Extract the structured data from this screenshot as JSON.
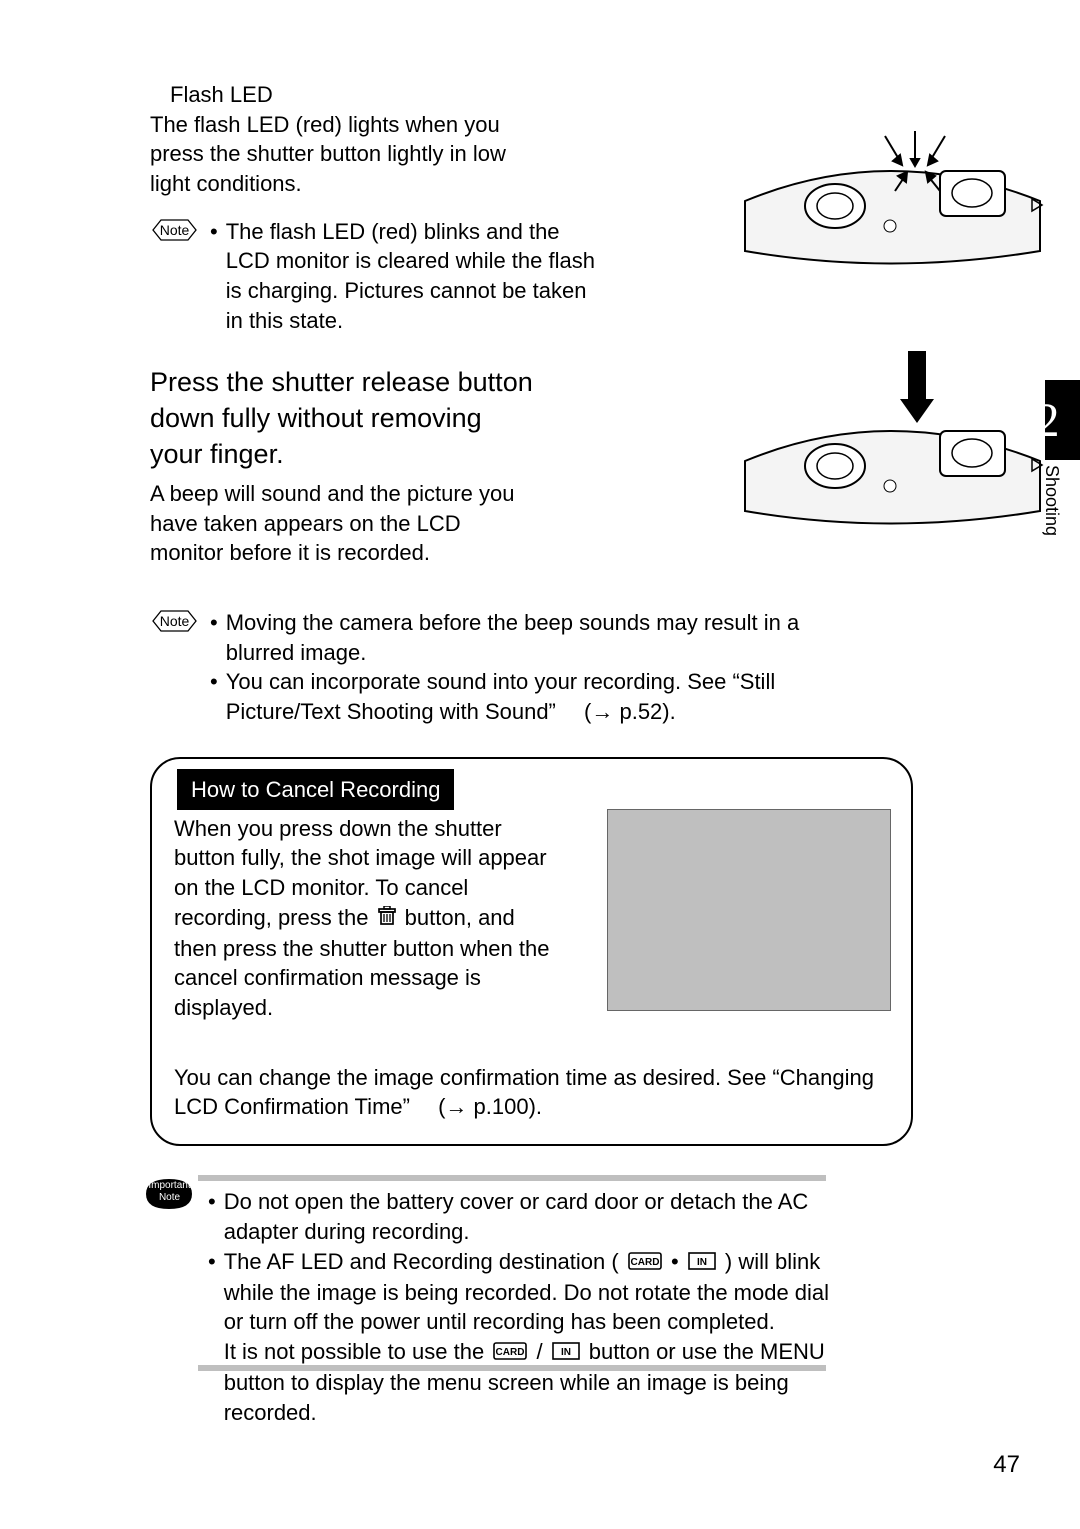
{
  "page_number": "47",
  "chapter": {
    "number": "2",
    "title": "Shooting"
  },
  "section": {
    "heading": "Flash LED",
    "intro": "The flash LED (red) lights when you press the shutter button lightly in low light conditions.",
    "note1_label": "Note",
    "note1_text": "The flash LED (red) blinks and the LCD monitor is cleared while the flash is charging. Pictures cannot be taken in this state."
  },
  "step": {
    "instruction": "Press the shutter release button down fully without removing your finger.",
    "result": "A beep will sound and the picture you have taken appears on the LCD monitor before it is recorded."
  },
  "note2": {
    "label": "Note",
    "items": [
      "Moving the camera before the beep sounds may result in a blurred image.",
      "You can incorporate sound into your recording. See “Still Picture/Text Shooting with Sound”"
    ],
    "ref": "p.52)."
  },
  "panel": {
    "title": "How to Cancel Recording",
    "text1_a": "When you press down the shutter button fully, the shot image will appear on the LCD monitor. To cancel recording, press the ",
    "text1_b": " button, and then press the shutter button when the cancel confirmation message is displayed.",
    "text2": "You can change the image confirmation time as desired. See “Changing LCD Confirmation Time”",
    "ref": "p.100)."
  },
  "important": {
    "label_top": "Important",
    "label_bottom": "Note",
    "item1": "Do not open the battery cover or card door or detach the AC adapter during recording.",
    "item2_a": "The AF LED and Recording destination ( ",
    "item2_b": " • ",
    "item2_c": " ) will blink while the image is being recorded. Do not rotate the mode dial or turn off the power until recording has been completed.",
    "item2_d": "It is not possible to use the ",
    "item2_e": " / ",
    "item2_f": " button or use the MENU button to display the menu screen while an image is being recorded."
  },
  "icons": {
    "trash": "trash-icon",
    "card": "CARD",
    "in": "IN"
  }
}
